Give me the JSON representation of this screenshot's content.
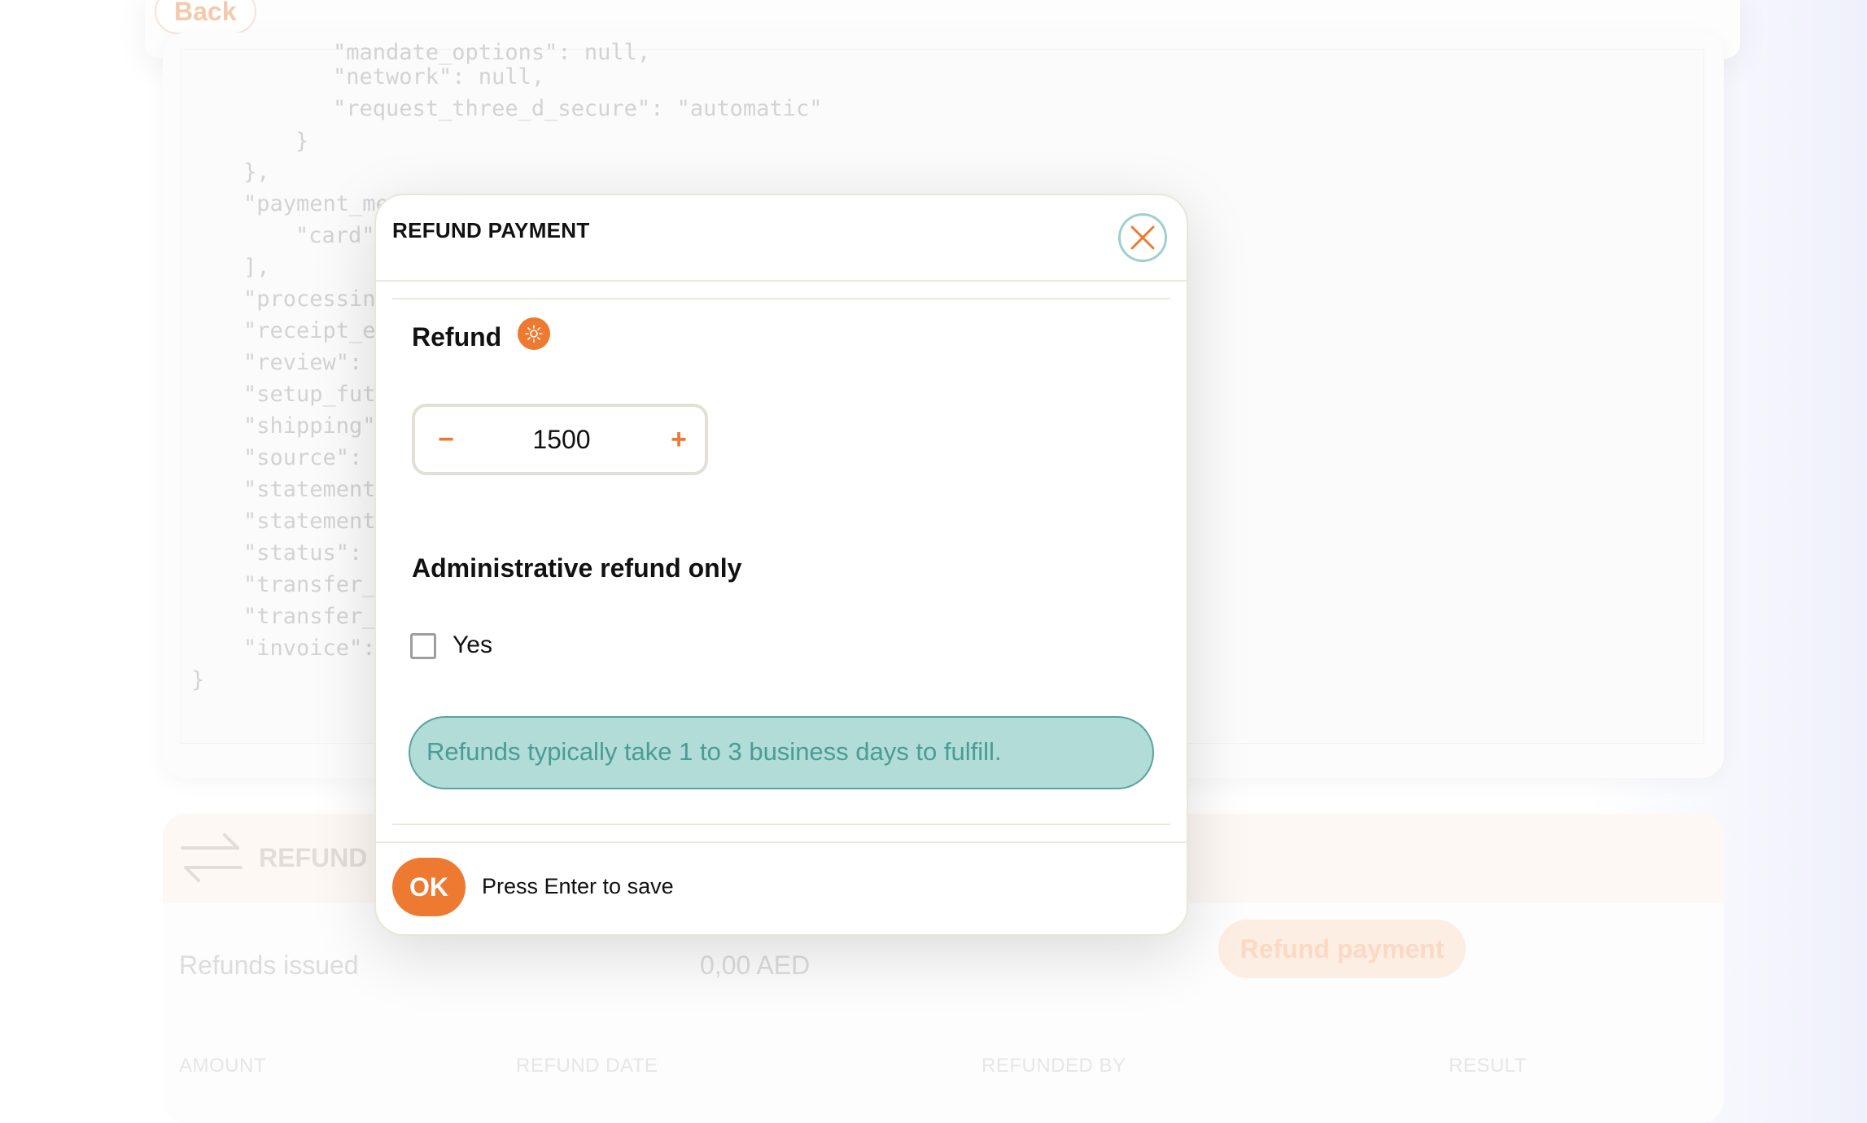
{
  "background": {
    "back_label": "Back",
    "json_lines": [
      "\"mandate_options\": null,",
      "\"network\": null,",
      "\"request_three_d_secure\": \"automatic\"",
      "}",
      "},",
      "\"payment_me",
      "\"card\"",
      "],",
      "\"processing",
      "\"receipt_em",
      "\"review\": n",
      "\"setup_futu",
      "\"shipping\"",
      "\"source\": n",
      "\"statement_",
      "\"statement_",
      "\"status\": \"",
      "\"transfer_d",
      "\"transfer_g",
      "\"invoice\":",
      "}"
    ],
    "refund_section_title": "REFUND",
    "refunds_issued_label": "Refunds issued",
    "refunds_issued_value": "0,00 AED",
    "refund_payment_label": "Refund payment",
    "columns": [
      "AMOUNT",
      "REFUND DATE",
      "REFUNDED BY",
      "RESULT"
    ]
  },
  "modal": {
    "title": "REFUND PAYMENT",
    "refund_label": "Refund",
    "amount_value": "1500",
    "minus_label": "−",
    "plus_label": "+",
    "admin_label": "Administrative refund only",
    "checkbox_label": "Yes",
    "checkbox_checked": false,
    "notice": "Refunds typically take 1 to 3 business days to fulfill.",
    "ok_label": "OK",
    "ok_hint": "Press Enter to save"
  },
  "colors": {
    "accent": "#ee7a31",
    "teal_bg": "#b1dcd8",
    "teal_text": "#4b9c95"
  },
  "icons": {
    "close": "close-icon",
    "info": "sun-info-icon",
    "refund": "swap-arrows-icon"
  }
}
